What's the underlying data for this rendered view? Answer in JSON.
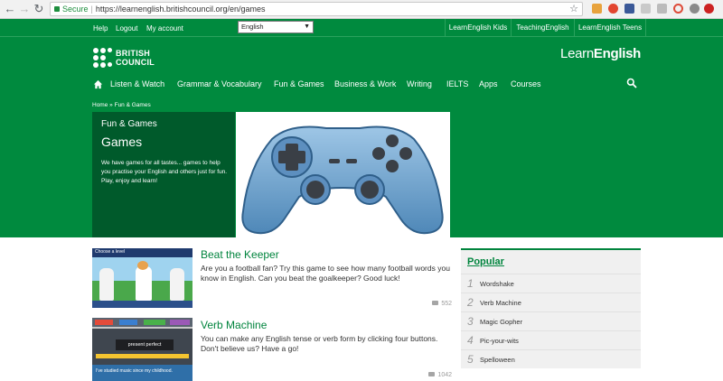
{
  "browser": {
    "secure_label": "Secure",
    "url": "https://learnenglish.britishcouncil.org/en/games"
  },
  "utility_nav": {
    "help": "Help",
    "logout": "Logout",
    "account": "My account",
    "language": "English"
  },
  "site_links": [
    "LearnEnglish Kids",
    "TeachingEnglish",
    "LearnEnglish Teens"
  ],
  "brand": {
    "bc_line1": "BRITISH",
    "bc_line2": "COUNCIL",
    "le_learn": "Learn",
    "le_english": "English"
  },
  "main_nav": [
    "Listen & Watch",
    "Grammar & Vocabulary",
    "Fun & Games",
    "Business & Work",
    "Writing",
    "IELTS",
    "Apps",
    "Courses"
  ],
  "breadcrumb": {
    "home": "Home",
    "sep": "»",
    "current": "Fun & Games"
  },
  "hero": {
    "subtitle": "Fun & Games",
    "title": "Games",
    "description": "We have games for all tastes... games to help you practise your English and others just for fun. Play, enjoy and learn!"
  },
  "games": [
    {
      "title": "Beat the Keeper",
      "description": "Are you a football fan? Try this game to see how many football words you know in English. Can you beat the goalkeeper? Good luck!",
      "comments": "552",
      "thumb_text": "Choose a level"
    },
    {
      "title": "Verb Machine",
      "description": "You can make any English tense or verb form by clicking four buttons. Don't believe us? Have a go!",
      "comments": "1042",
      "thumb_text": "present perfect",
      "thumb_caption": "I've studied music since my childhood."
    }
  ],
  "popular": {
    "title": "Popular",
    "items": [
      {
        "num": "1",
        "label": "Wordshake"
      },
      {
        "num": "2",
        "label": "Verb Machine"
      },
      {
        "num": "3",
        "label": "Magic Gopher"
      },
      {
        "num": "4",
        "label": "Pic-your-wits"
      },
      {
        "num": "5",
        "label": "Spelloween"
      }
    ]
  },
  "colors": {
    "brand_green": "#008a3e",
    "dark_green": "#005a2b",
    "link_green": "#00843d"
  },
  "icons": [
    "back-icon",
    "forward-icon",
    "reload-icon",
    "lock-icon",
    "star-icon",
    "home-icon",
    "search-icon",
    "comment-icon"
  ]
}
